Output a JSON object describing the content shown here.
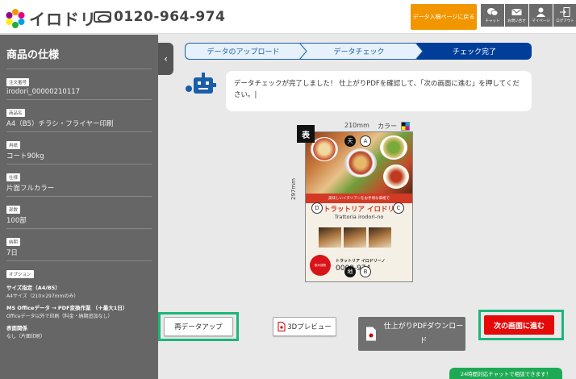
{
  "header": {
    "logo_text": "イロドリ",
    "phone": "0120-964-974",
    "back_button": "データ入稿ページに戻る",
    "icons": [
      {
        "label": "チャット",
        "icon": "chat-icon"
      },
      {
        "label": "お問い合せ",
        "icon": "mail-icon"
      },
      {
        "label": "マイページ",
        "icon": "user-icon"
      },
      {
        "label": "ログアウト",
        "icon": "logout-icon"
      }
    ]
  },
  "sidebar": {
    "title": "商品の仕様",
    "order_no_label": "注文番号",
    "order_no": "irodori_00000210117",
    "product_label": "商品名",
    "product": "A4（B5）チラシ・フライヤー印刷",
    "paper_label": "用紙",
    "paper": "コート90kg",
    "spec_label": "仕様",
    "spec": "片面フルカラー",
    "qty_label": "部数",
    "qty": "100部",
    "delivery_label": "納期",
    "delivery": "7日",
    "options_label": "オプション",
    "options": [
      {
        "title": "サイズ指定（A4/B5）",
        "value": "A4サイズ（210×297mmのみ）"
      },
      {
        "title": "MS Officeデータ → PDF変換作業 （＋最大1日）",
        "value": "Officeデータ以外で印刷（料金・納期追加なし）"
      },
      {
        "title": "表面関係",
        "value": "なし（片面印刷）"
      }
    ]
  },
  "steps": [
    "データのアップロード",
    "データチェック",
    "チェック完了"
  ],
  "message": "データチェックが完了しました！ 仕上がりPDFを確認して、「次の画面に進む」を押してください。|",
  "preview": {
    "face": "表",
    "width": "210mm",
    "color_label": "カラー",
    "height": "297mm",
    "marks": {
      "top": "天",
      "a": "A",
      "d": "D",
      "c": "C",
      "bottom": "地",
      "b": "B"
    },
    "flyer_tagline": "美味しいイタリアンをお手頃な価格で",
    "flyer_title": "トラットリア イロドリ",
    "flyer_subtitle": "Trattoria irodori-no",
    "flyer_badge": "飲み放題",
    "flyer_shop": "トラットリア イロドリーノ",
    "flyer_tel": "0000-974"
  },
  "buttons": {
    "reupload": "再データアップ",
    "preview3d": "3Dプレビュー",
    "pdf_download": "仕上がりPDFダウンロード",
    "next": "次の画面に進む"
  },
  "chat_tab": "24時間対応チャットで相談できます！",
  "colors": {
    "accent": "#f29600",
    "step_active": "#003e9a",
    "next": "#e40a0a",
    "highlight": "#1db67a"
  }
}
